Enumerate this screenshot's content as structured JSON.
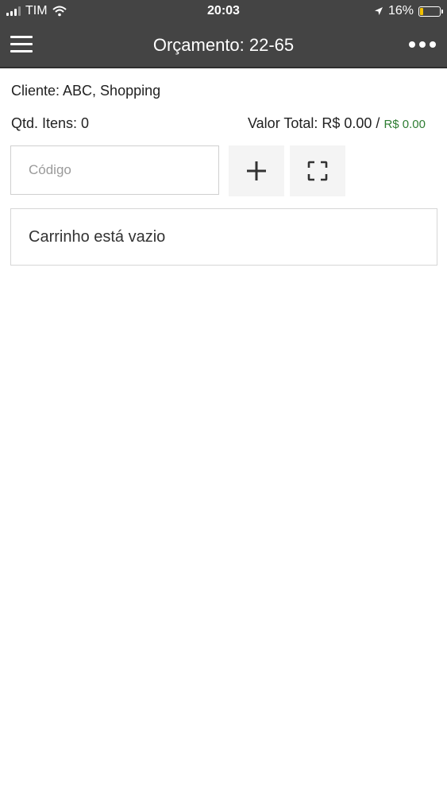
{
  "status_bar": {
    "carrier": "TIM",
    "time": "20:03",
    "battery_percent": "16%",
    "battery_level": 0.16
  },
  "nav": {
    "title": "Orçamento: 22-65",
    "menu_icon": "hamburger-menu-icon",
    "more_icon": "more-dots-icon"
  },
  "order": {
    "client": "Cliente: ABC, Shopping",
    "qty": "Qtd. Itens: 0",
    "total_label": "Valor Total: R$ 0.00 /",
    "total_secondary": "R$ 0.00"
  },
  "input": {
    "placeholder": "Código",
    "value": ""
  },
  "actions": {
    "add_icon": "plus-icon",
    "scan_icon": "scan-frame-icon"
  },
  "cart": {
    "empty_message": "Carrinho está vazio"
  },
  "colors": {
    "header_bg": "#444444",
    "accent_green": "#2e7d32",
    "battery_low": "#f2c100"
  }
}
